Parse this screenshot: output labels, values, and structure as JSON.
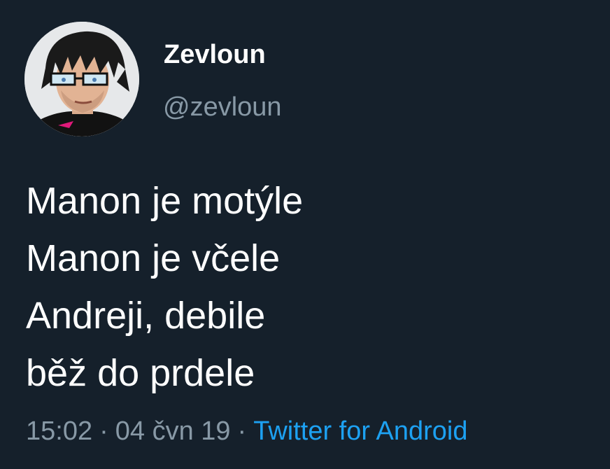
{
  "user": {
    "display_name": "Zevloun",
    "handle": "@zevloun"
  },
  "tweet": {
    "lines": [
      "Manon je motýle",
      "Manon je včele",
      "Andreji, debile",
      "běž do prdele"
    ],
    "time": "15:02",
    "date": "04 čvn 19",
    "separator": "·",
    "source": "Twitter for Android"
  },
  "colors": {
    "background": "#15202b",
    "text": "#ffffff",
    "secondary_text": "#8899a6",
    "link": "#1da1f2"
  }
}
